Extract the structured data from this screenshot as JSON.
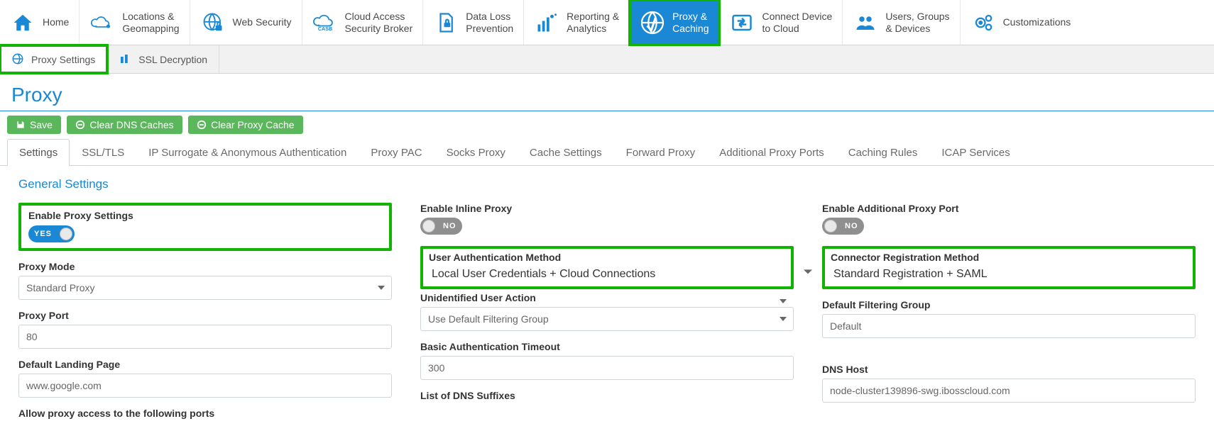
{
  "topnav": {
    "items": [
      {
        "label": "Home"
      },
      {
        "label": "Locations &\nGeomapping"
      },
      {
        "label": "Web Security"
      },
      {
        "label": "Cloud Access\nSecurity Broker"
      },
      {
        "label": "Data Loss\nPrevention"
      },
      {
        "label": "Reporting &\nAnalytics"
      },
      {
        "label": "Proxy &\nCaching"
      },
      {
        "label": "Connect Device\nto Cloud"
      },
      {
        "label": "Users, Groups\n& Devices"
      },
      {
        "label": "Customizations"
      }
    ],
    "active_index": 6
  },
  "subnav": {
    "tabs": [
      {
        "label": "Proxy Settings"
      },
      {
        "label": "SSL Decryption"
      }
    ],
    "active_index": 0
  },
  "page": {
    "title": "Proxy"
  },
  "actions": {
    "save": "Save",
    "clear_dns": "Clear DNS Caches",
    "clear_proxy": "Clear Proxy Cache"
  },
  "settings_tabs": [
    "Settings",
    "SSL/TLS",
    "IP Surrogate & Anonymous Authentication",
    "Proxy PAC",
    "Socks Proxy",
    "Cache Settings",
    "Forward Proxy",
    "Additional Proxy Ports",
    "Caching Rules",
    "ICAP Services"
  ],
  "settings_tabs_active": 0,
  "general": {
    "title": "General Settings",
    "col1": {
      "enable_proxy": {
        "label": "Enable Proxy Settings",
        "value": "YES",
        "on": true
      },
      "proxy_mode": {
        "label": "Proxy Mode",
        "value": "Standard Proxy"
      },
      "proxy_port": {
        "label": "Proxy Port",
        "value": "80"
      },
      "landing": {
        "label": "Default Landing Page",
        "value": "www.google.com"
      },
      "allow_ports": {
        "label": "Allow proxy access to the following ports"
      }
    },
    "col2": {
      "enable_inline": {
        "label": "Enable Inline Proxy",
        "value": "NO",
        "on": false
      },
      "auth_method": {
        "label": "User Authentication Method",
        "value": "Local User Credentials + Cloud Connections"
      },
      "unidentified": {
        "label": "Unidentified User Action",
        "value": "Use Default Filtering Group"
      },
      "basic_timeout": {
        "label": "Basic Authentication Timeout",
        "value": "300"
      },
      "dns_suffixes": {
        "label": "List of DNS Suffixes"
      }
    },
    "col3": {
      "enable_add_port": {
        "label": "Enable Additional Proxy Port",
        "value": "NO",
        "on": false
      },
      "connector_reg": {
        "label": "Connector Registration Method",
        "value": "Standard Registration + SAML"
      },
      "default_group": {
        "label": "Default Filtering Group",
        "value": "Default"
      },
      "dns_host": {
        "label": "DNS Host",
        "value": "node-cluster139896-swg.ibosscloud.com"
      }
    }
  }
}
